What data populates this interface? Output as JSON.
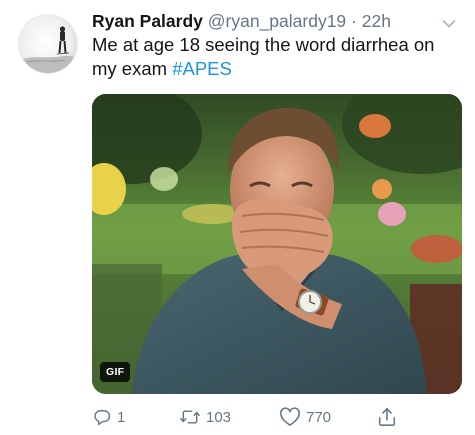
{
  "tweet": {
    "display_name": "Ryan Palardy",
    "handle": "@ryan_palardy19",
    "separator": "·",
    "time": "22h",
    "text_before_hashtag": "Me at age 18 seeing the word diarrhea on my exam ",
    "hashtag": "#APES"
  },
  "media": {
    "badge": "GIF",
    "description_icon": "laughing-man-gif"
  },
  "actions": {
    "reply_count": "1",
    "retweet_count": "103",
    "like_count": "770"
  },
  "colors": {
    "text": "#14171a",
    "secondary": "#657786",
    "link": "#1b95e0"
  },
  "icons": [
    "reply-icon",
    "retweet-icon",
    "like-icon",
    "share-icon",
    "chevron-down-icon"
  ]
}
